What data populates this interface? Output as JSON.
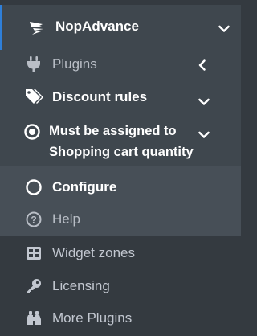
{
  "menu": {
    "nopadvance": {
      "label": "NopAdvance"
    },
    "plugins": {
      "label": "Plugins"
    },
    "discount_rules": {
      "label": "Discount rules"
    },
    "must_be_assigned": {
      "label": "Must be assigned to Shopping cart quantity"
    },
    "configure": {
      "label": "Configure"
    },
    "help": {
      "label": "Help"
    },
    "widget_zones": {
      "label": "Widget zones"
    },
    "licensing": {
      "label": "Licensing"
    },
    "more_plugins": {
      "label": "More Plugins"
    }
  },
  "icons": {
    "nopadvance": "nopadvance-logo-icon",
    "plugins": "plug-icon",
    "discount_rules": "tags-icon",
    "must_be_assigned": "dot-circle-icon",
    "configure": "circle-icon",
    "help": "question-circle-icon",
    "widget_zones": "grid-icon",
    "licensing": "key-icon",
    "more_plugins": "binoculars-icon"
  },
  "colors": {
    "sidebar_bg": "#343a40",
    "active_bg": "#3f474e",
    "nested_bg": "#474f57",
    "active_accent": "#2f7fd8",
    "text_active": "#ffffff",
    "text_muted": "#c2c7d0"
  }
}
